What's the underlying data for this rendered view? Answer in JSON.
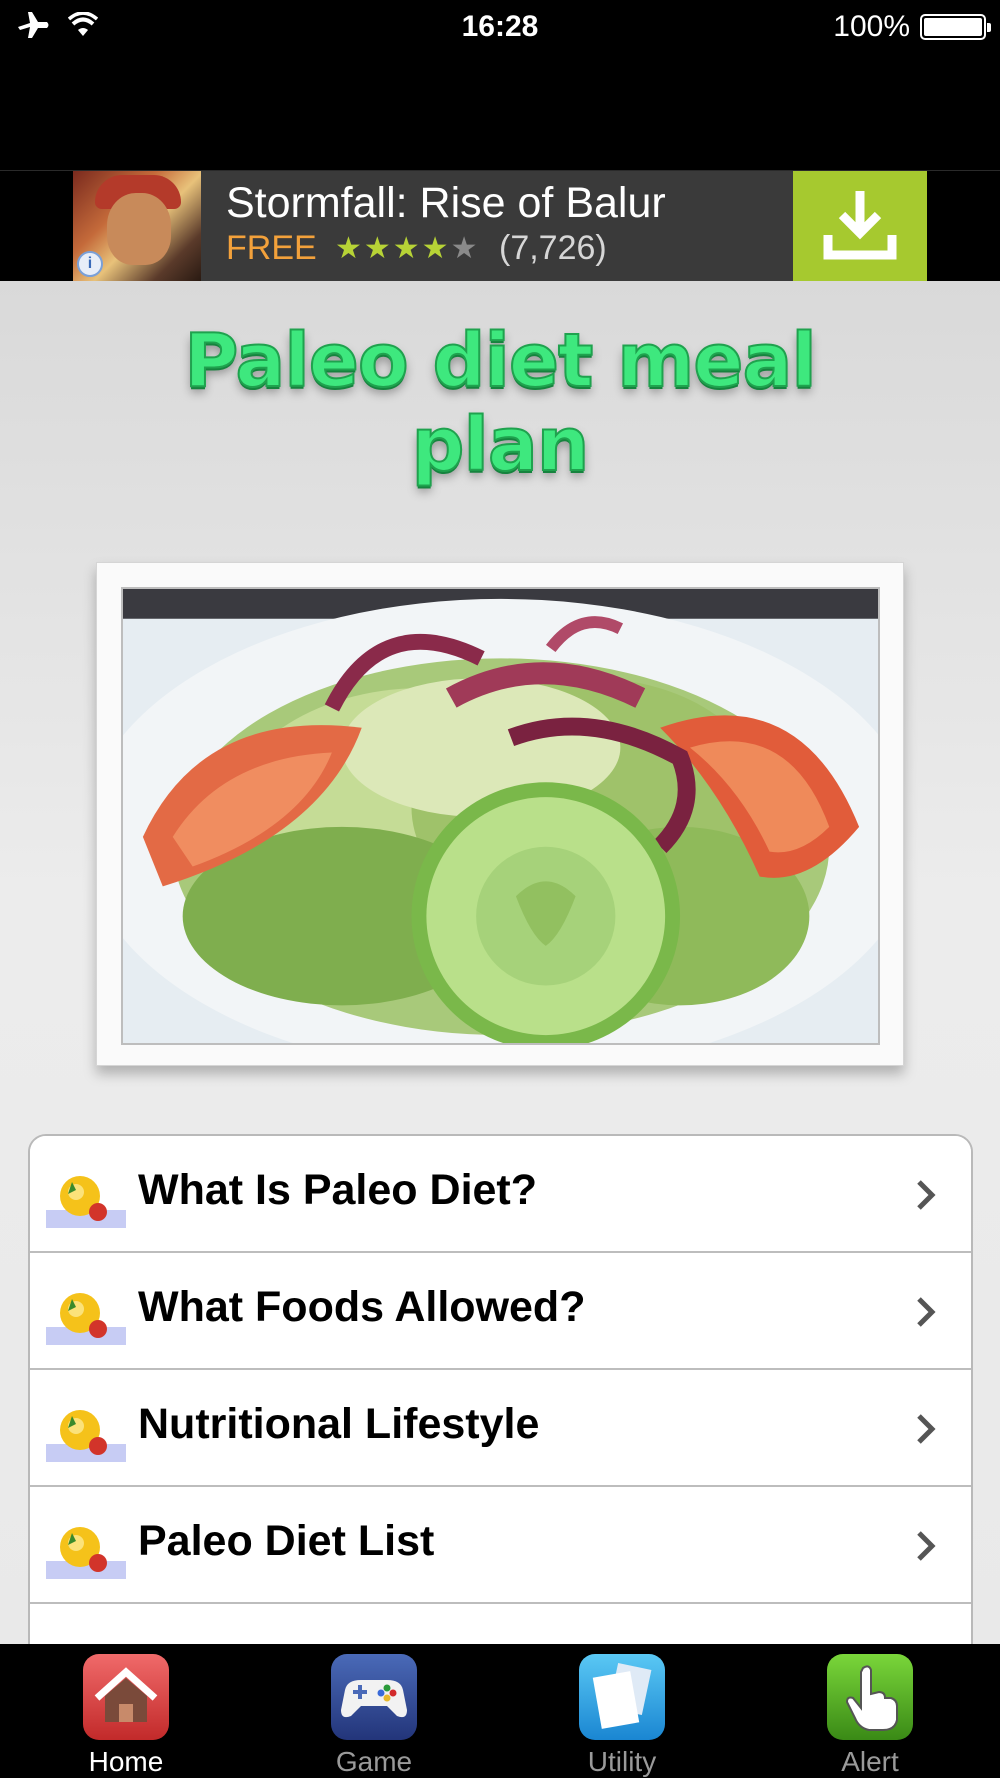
{
  "status_bar": {
    "time": "16:28",
    "battery": "100%",
    "icons": [
      "airplane-icon",
      "wifi-icon",
      "battery-icon"
    ]
  },
  "ad": {
    "title": "Stormfall: Rise of Balur",
    "price": "FREE",
    "stars": "★★★★★",
    "rating": 4.5,
    "review_count": "(7,726)",
    "icons": [
      "game-thumbnail",
      "info-icon",
      "download-icon"
    ],
    "colors": {
      "price": "#f3a13b",
      "stars": "#b7d336",
      "download_bg": "#a6c92f"
    }
  },
  "header": {
    "title": "Paleo diet meal plan"
  },
  "menu": {
    "items": [
      {
        "label": "What Is Paleo Diet?",
        "icon": "fruit-icon"
      },
      {
        "label": "What Foods Allowed?",
        "icon": "fruit-icon"
      },
      {
        "label": "Nutritional Lifestyle",
        "icon": "fruit-icon"
      },
      {
        "label": "Paleo Diet List",
        "icon": "fruit-icon"
      },
      {
        "label": "",
        "icon": "fruit-icon"
      }
    ]
  },
  "tabbar": {
    "tabs": [
      {
        "label": "Home",
        "icon": "home-icon",
        "active": true
      },
      {
        "label": "Game",
        "icon": "gamepad-icon",
        "active": false
      },
      {
        "label": "Utility",
        "icon": "documents-icon",
        "active": false
      },
      {
        "label": "Alert",
        "icon": "pointer-hand-icon",
        "active": false
      }
    ]
  }
}
